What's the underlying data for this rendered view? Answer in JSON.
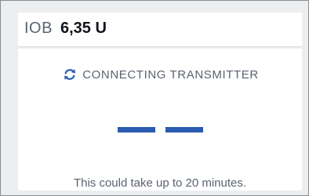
{
  "iob": {
    "label": "IOB",
    "value": "6,35 U"
  },
  "status": {
    "icon": "refresh-icon",
    "text": "CONNECTING TRANSMITTER",
    "accent_color": "#2b5bb0"
  },
  "glucose": {
    "placeholder_segments": 2
  },
  "hint": {
    "text": "This could take up to 20 minutes."
  }
}
